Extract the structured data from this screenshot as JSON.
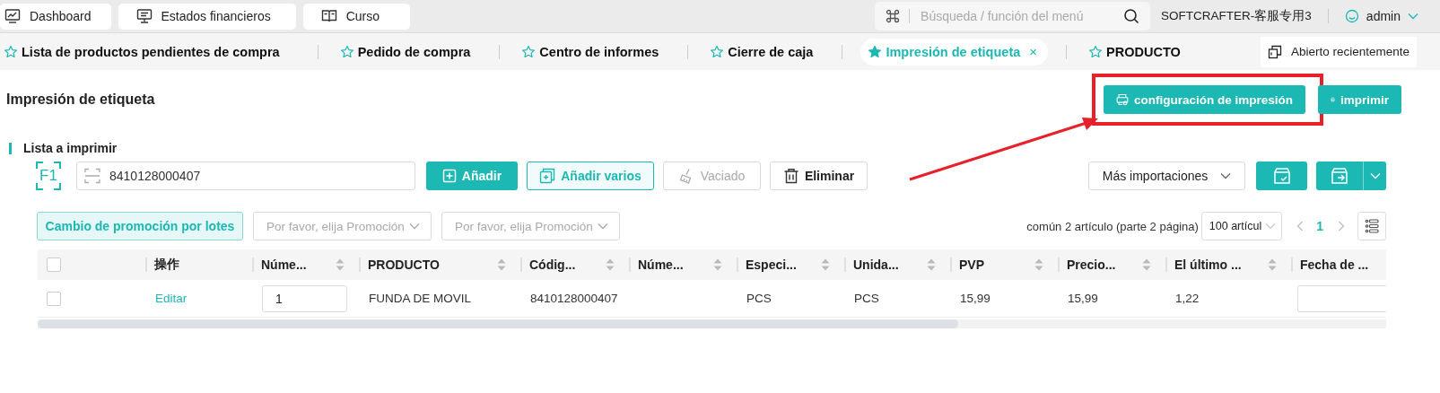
{
  "top_tabs": [
    {
      "label": "Dashboard",
      "kind": "chart"
    },
    {
      "label": "Estados financieros",
      "kind": "monitor"
    },
    {
      "label": "Curso",
      "kind": "book"
    }
  ],
  "search": {
    "placeholder": "Búsqueda / función del menú"
  },
  "company": "SOFTCRAFTER-客服专用3",
  "user": "admin",
  "page_tabs": [
    {
      "label": "Lista de productos pendientes de compra",
      "selected": false
    },
    {
      "label": "Pedido de compra",
      "selected": false
    },
    {
      "label": "Centro de informes",
      "selected": false
    },
    {
      "label": "Cierre de caja",
      "selected": false
    },
    {
      "label": "Impresión de etiqueta",
      "selected": true,
      "close": "×"
    },
    {
      "label": "PRODUCTO",
      "selected": false
    }
  ],
  "recent": "Abierto recientemente",
  "page_title": "Impresión de etiqueta",
  "header_buttons": [
    {
      "label": "configuración de impresión",
      "kind": "settings",
      "highlighted": true
    },
    {
      "label": "imprimir",
      "kind": "print",
      "highlighted": false
    }
  ],
  "section_title": "Lista a imprimir",
  "scan_key": "F1",
  "barcode_input": {
    "value": "8410128000407"
  },
  "actions": [
    {
      "label": "Añadir",
      "kind": "primary"
    },
    {
      "label": "Añadir varios",
      "kind": "light"
    },
    {
      "label": "Vaciado",
      "kind": "disabled"
    },
    {
      "label": "Eliminar",
      "kind": "default"
    }
  ],
  "more_imports": "Más importaciones",
  "batch_button": "Cambio de promoción por lotes",
  "promo_selects": [
    {
      "placeholder": "Por favor, elija Promoción"
    },
    {
      "placeholder": "Por favor, elija Promoción"
    }
  ],
  "pagination": {
    "summary": "común 2 artículo (parte 2 página)",
    "page_size": "100 artícul",
    "page": "1"
  },
  "table": {
    "select_all": {
      "checked": false
    },
    "columns": [
      {
        "label": "操作",
        "sortable": false
      },
      {
        "label": "Núme...",
        "sortable": true
      },
      {
        "label": "PRODUCTO",
        "sortable": true
      },
      {
        "label": "Códig...",
        "sortable": true
      },
      {
        "label": "Núme...",
        "sortable": true
      },
      {
        "label": "Especi...",
        "sortable": true
      },
      {
        "label": "Unida...",
        "sortable": true
      },
      {
        "label": "PVP",
        "sortable": true
      },
      {
        "label": "Precio...",
        "sortable": true
      },
      {
        "label": "El último ...",
        "sortable": true
      },
      {
        "label": "Fecha de ...",
        "sortable": false
      }
    ],
    "rows": [
      {
        "checked": false,
        "cells": [
          {
            "kind": "link",
            "text": "Editar"
          },
          {
            "kind": "input",
            "text": "1"
          },
          {
            "kind": "text",
            "text": "FUNDA DE MOVIL"
          },
          {
            "kind": "text",
            "text": "8410128000407"
          },
          {
            "kind": "empty"
          },
          {
            "kind": "text",
            "text": "PCS"
          },
          {
            "kind": "text",
            "text": "PCS"
          },
          {
            "kind": "text",
            "text": "15,99"
          },
          {
            "kind": "text",
            "text": "15,99"
          },
          {
            "kind": "text",
            "text": "1,22"
          },
          {
            "kind": "input"
          }
        ]
      }
    ]
  }
}
